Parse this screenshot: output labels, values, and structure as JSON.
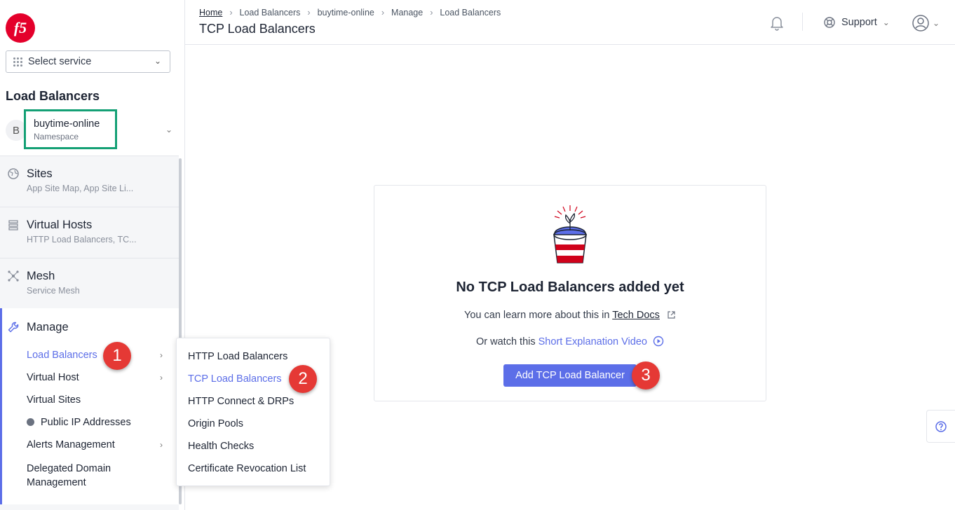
{
  "app": {
    "logo_text": "f5"
  },
  "sidebar": {
    "select_service": "Select service",
    "section_title": "Load Balancers",
    "namespace": {
      "avatar": "B",
      "name": "buytime-online",
      "label": "Namespace"
    },
    "groups": [
      {
        "title": "Sites",
        "subtitle": "App Site Map, App Site Li..."
      },
      {
        "title": "Virtual Hosts",
        "subtitle": "HTTP Load Balancers, TC..."
      },
      {
        "title": "Mesh",
        "subtitle": "Service Mesh"
      }
    ],
    "manage": {
      "title": "Manage",
      "items": [
        {
          "label": "Load Balancers"
        },
        {
          "label": "Virtual Host"
        },
        {
          "label": "Virtual Sites"
        },
        {
          "label": "Public IP Addresses"
        },
        {
          "label": "Alerts Management"
        },
        {
          "label": "Delegated Domain Management"
        }
      ]
    }
  },
  "popup": {
    "items": [
      {
        "label": "HTTP Load Balancers"
      },
      {
        "label": "TCP Load Balancers"
      },
      {
        "label": "HTTP Connect & DRPs"
      },
      {
        "label": "Origin Pools"
      },
      {
        "label": "Health Checks"
      },
      {
        "label": "Certificate Revocation List"
      }
    ]
  },
  "header": {
    "breadcrumb": [
      "Home",
      "Load Balancers",
      "buytime-online",
      "Manage",
      "Load Balancers"
    ],
    "title": "TCP Load Balancers",
    "support_label": "Support"
  },
  "empty_state": {
    "headline": "No TCP Load Balancers added yet",
    "learn_prefix": "You can learn more about this in ",
    "learn_link": "Tech Docs",
    "watch_prefix": "Or watch this ",
    "watch_link": "Short Explanation Video",
    "button": "Add TCP Load Balancer"
  },
  "annotations": {
    "badge1": "1",
    "badge2": "2",
    "badge3": "3"
  },
  "colors": {
    "accent": "#5c6ee8",
    "highlight_border": "#14a075",
    "badge": "#e53935",
    "brand": "#e4002b"
  }
}
